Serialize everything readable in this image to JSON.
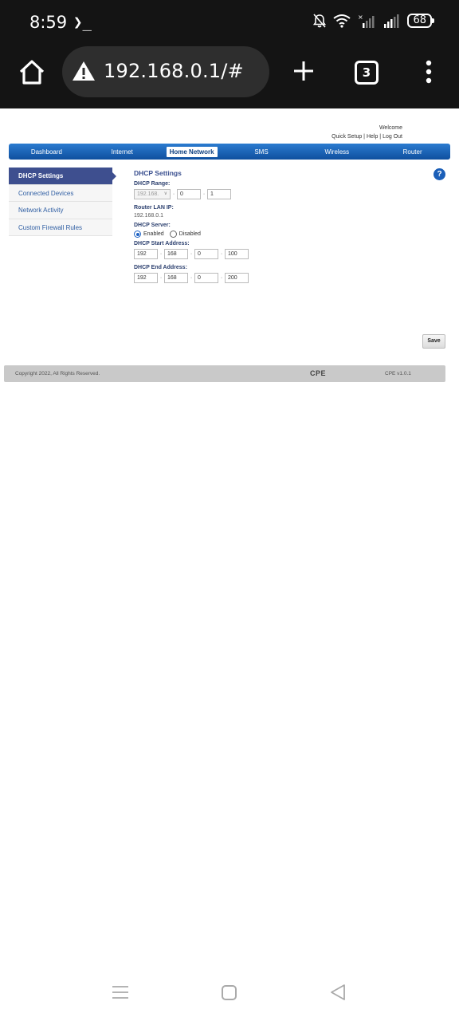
{
  "status_bar": {
    "time": "8:59",
    "terminal_glyph": "❯_",
    "battery": "68",
    "icons": [
      "terminal-icon",
      "bell-off-icon",
      "wifi-icon",
      "signal-icon",
      "signal-icon-2",
      "battery-icon"
    ]
  },
  "browser": {
    "url": "192.168.0.1/#",
    "tab_count": "3",
    "icons": [
      "home-icon",
      "warning-icon",
      "plus-icon",
      "tabs-icon",
      "menu-icon"
    ]
  },
  "header": {
    "welcome": "Welcome",
    "links": [
      "Quick Setup",
      "Help",
      "Log Out"
    ],
    "separator": " | "
  },
  "nav": {
    "items": [
      "Dashboard",
      "Internet",
      "Home Network",
      "SMS",
      "Wireless",
      "Router"
    ],
    "active": "Home Network"
  },
  "sidebar": {
    "items": [
      "DHCP Settings",
      "Connected Devices",
      "Network Activity",
      "Custom Firewall Rules"
    ],
    "active": "DHCP Settings"
  },
  "dhcp": {
    "title": "DHCP Settings",
    "range_label": "DHCP Range:",
    "range": {
      "prefix": "192.168.",
      "octet3": "0",
      "octet4": "1"
    },
    "router_ip_label": "Router LAN IP:",
    "router_ip": "192.168.0.1",
    "server_label": "DHCP Server:",
    "server_options": [
      "Enabled",
      "Disabled"
    ],
    "server_selected": "Enabled",
    "start_label": "DHCP Start Address:",
    "start": [
      "192",
      "168",
      "0",
      "100"
    ],
    "end_label": "DHCP End Address:",
    "end": [
      "192",
      "168",
      "0",
      "200"
    ],
    "help_glyph": "?",
    "save_label": "Save"
  },
  "footer": {
    "copyright": "Copyright 2022, All Rights Reserved.",
    "brand": "CPE",
    "version": "CPE v1.0.1"
  },
  "colors": {
    "nav_blue": "#0f4f9e",
    "sidebar_active": "#3e4f8f",
    "status_bg": "#141414",
    "footer_bg": "#c9c9c9"
  }
}
